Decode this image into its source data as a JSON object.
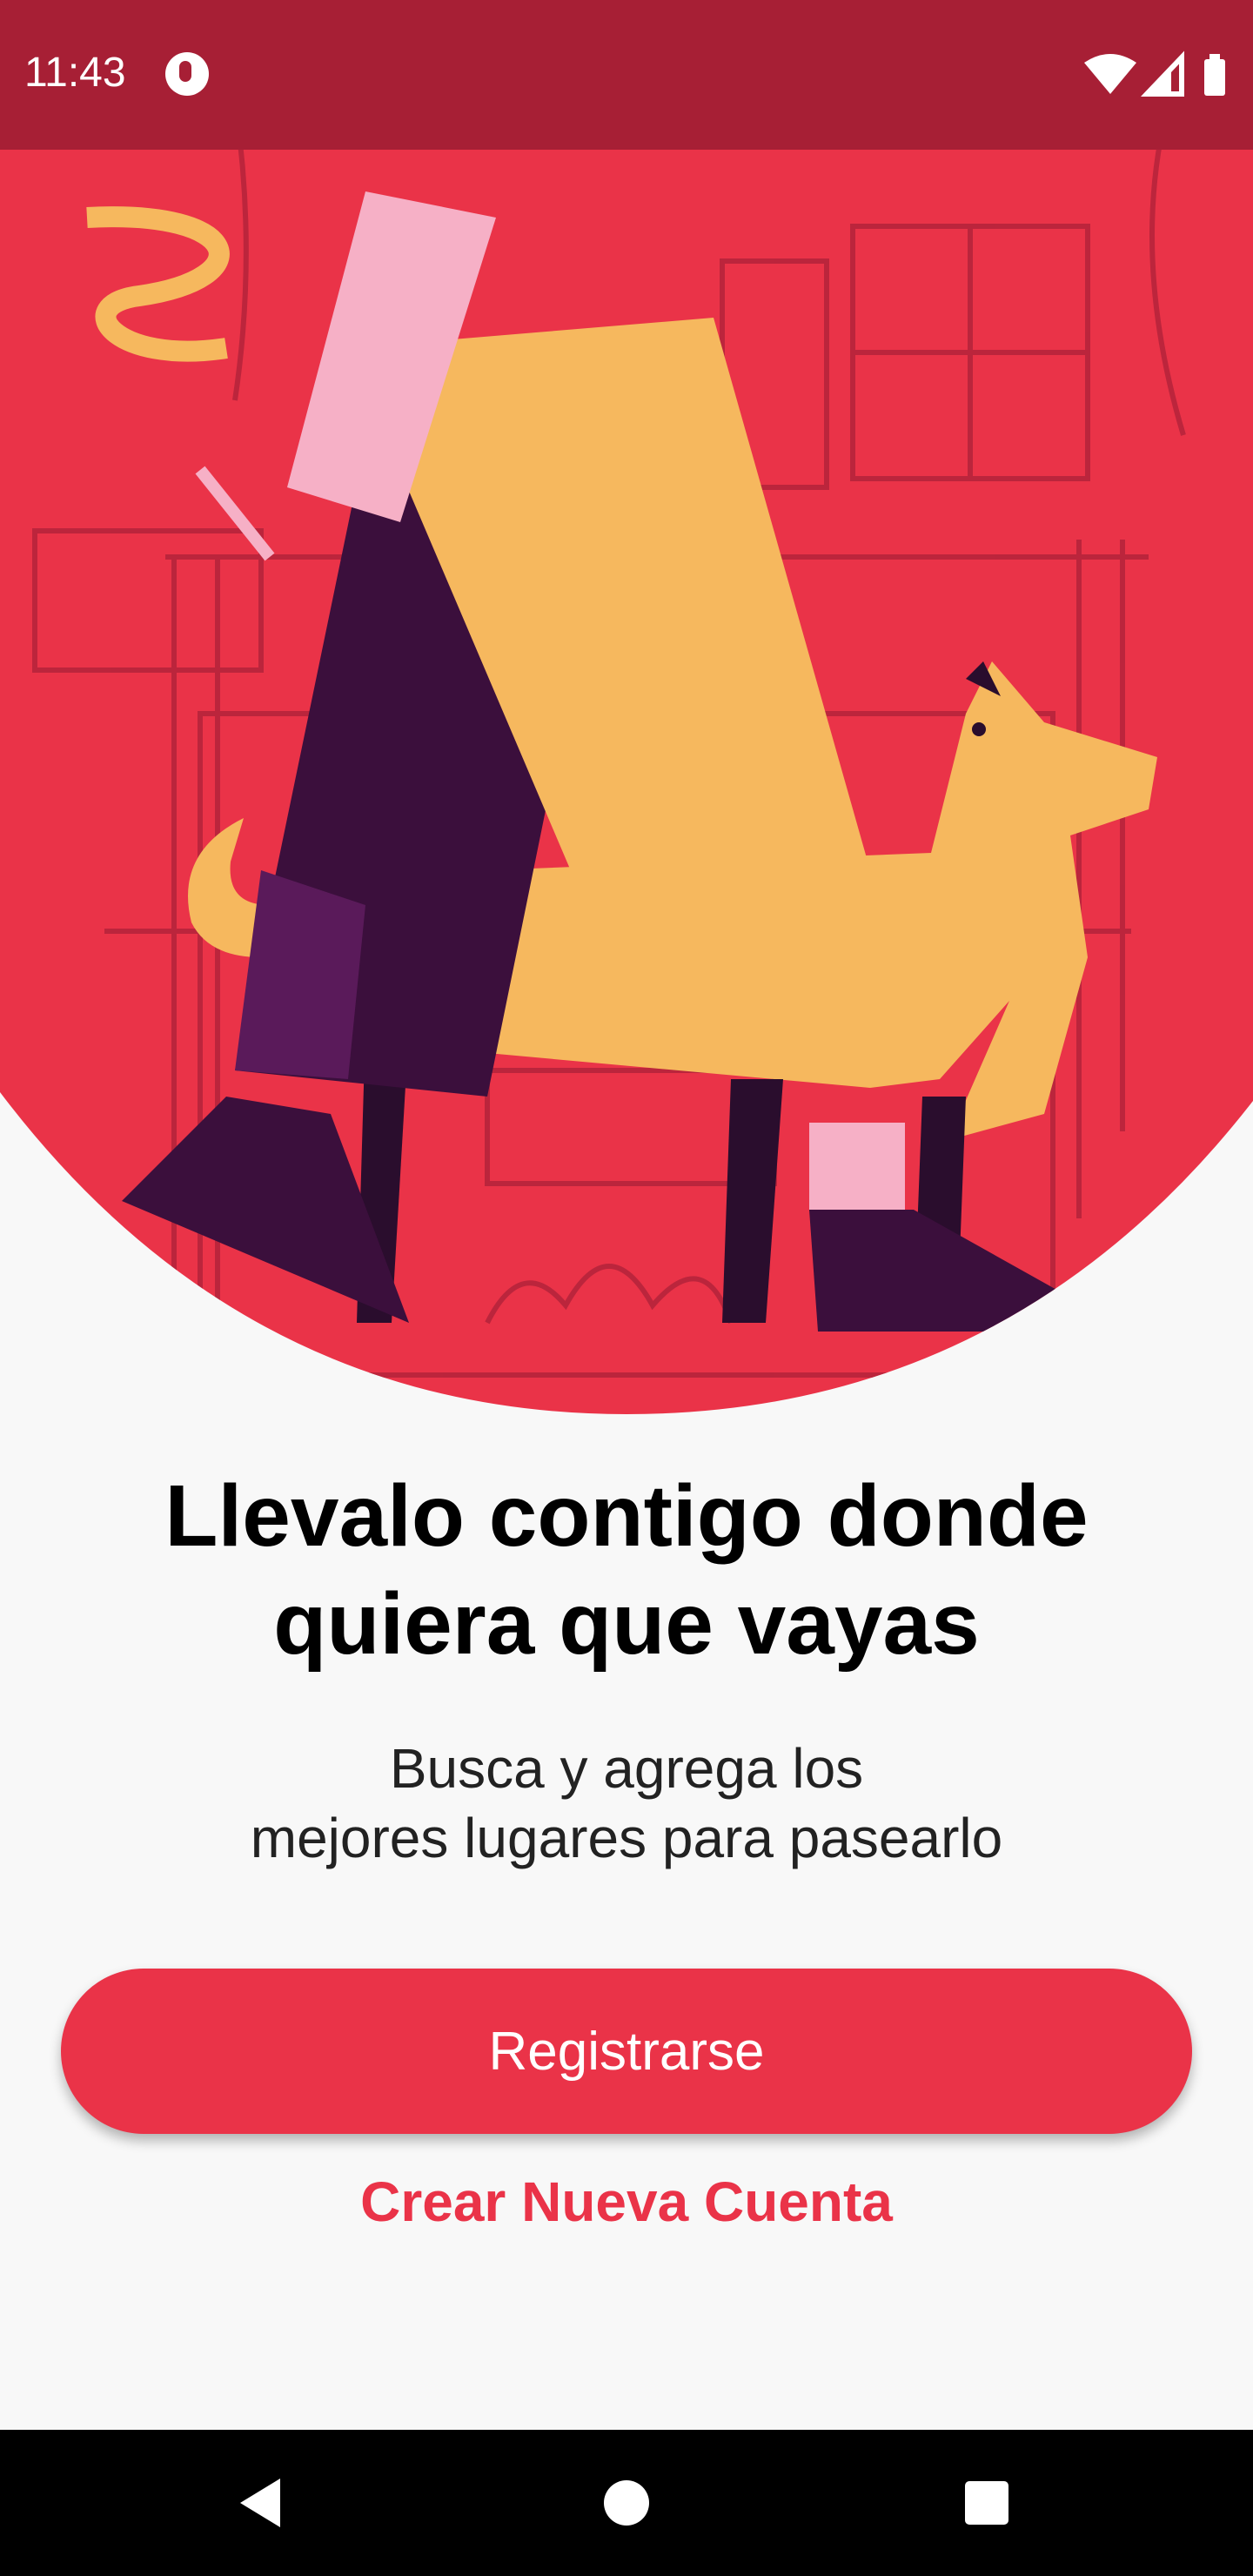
{
  "status_bar": {
    "time": "11:43",
    "icons": [
      "app-notification-icon",
      "wifi-icon",
      "cellular-signal-icon",
      "battery-icon"
    ]
  },
  "hero": {
    "illustration": "illustration of a person walking a dog in front of a building",
    "colors": {
      "background": "#ea3348",
      "figure": "#f6b85e",
      "shadow": "#3b0f3c"
    }
  },
  "content": {
    "title_line1": "Llevalo contigo donde",
    "title_line2": "quiera que vayas",
    "subtitle_line1": "Busca y agrega los",
    "subtitle_line2": "mejores lugares para pasearlo"
  },
  "actions": {
    "primary_label": "Registrarse",
    "secondary_label": "Crear Nueva Cuenta"
  },
  "nav_bar": {
    "icons": [
      "back-icon",
      "home-icon",
      "recents-icon"
    ]
  },
  "colors": {
    "accent": "#ea3348",
    "status_bar": "#a71f35",
    "background": "#f8f8f8"
  }
}
